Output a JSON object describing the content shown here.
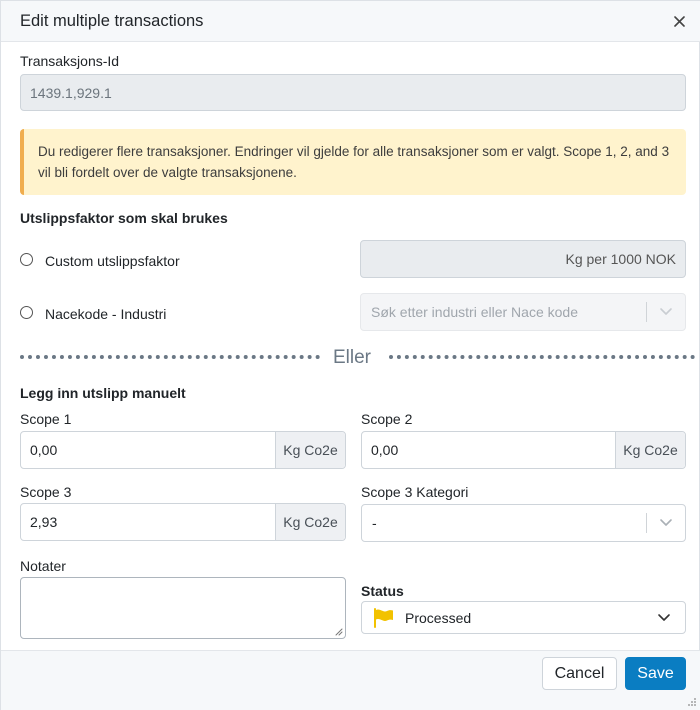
{
  "modal": {
    "title": "Edit multiple transactions"
  },
  "transaction_id": {
    "label": "Transaksjons-Id",
    "value": "1439.1,929.1"
  },
  "alert": {
    "text": "Du redigerer flere transaksjoner. Endringer vil gjelde for alle transaksjoner som er valgt. Scope 1, 2, and 3 vil bli fordelt over de valgte transaksjonene."
  },
  "emission_factor": {
    "title": "Utslippsfaktor som skal brukes",
    "custom_label": "Custom utslippsfaktor",
    "custom_placeholder": "Kg per 1000 NOK",
    "nace_label": "Nacekode - Industri",
    "nace_placeholder": "Søk etter industri eller Nace kode"
  },
  "divider": {
    "text": "Eller"
  },
  "manual": {
    "title": "Legg inn utslipp manuelt",
    "scope1_label": "Scope 1",
    "scope1_value": "0,00",
    "scope2_label": "Scope 2",
    "scope2_value": "0,00",
    "scope3_label": "Scope 3",
    "scope3_value": "2,93",
    "unit": "Kg Co2e",
    "scope3_category_label": "Scope 3 Kategori",
    "scope3_category_value": "-"
  },
  "notes": {
    "label": "Notater",
    "value": ""
  },
  "status": {
    "label": "Status",
    "value": "Processed",
    "flag_color": "#f2c200"
  },
  "footer": {
    "cancel_label": "Cancel",
    "save_label": "Save"
  },
  "colors": {
    "primary": "#0a7dc2",
    "alert_bg": "#fff3cd",
    "alert_border": "#f0ad4e"
  }
}
